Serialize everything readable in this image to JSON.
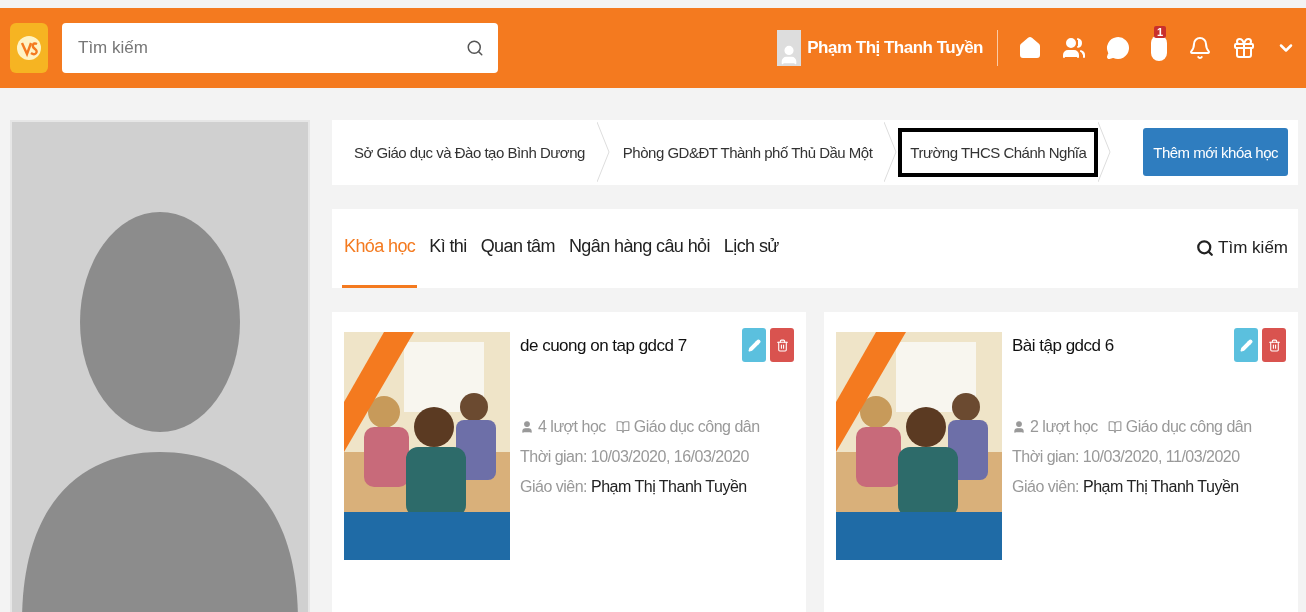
{
  "header": {
    "search": {
      "placeholder": "Tìm kiếm"
    },
    "user": {
      "name": "Phạm Thị Thanh Tuyền"
    },
    "notification_count": "1"
  },
  "breadcrumb": [
    {
      "label": "Sở Giáo dục và Đào tạo Bình Dương",
      "highlighted": false
    },
    {
      "label": "Phòng GD&ĐT Thành phố Thủ Dầu Một",
      "highlighted": false
    },
    {
      "label": "Trường THCS Chánh Nghĩa",
      "highlighted": true
    }
  ],
  "add_button": "Thêm mới khóa học",
  "tabs": [
    {
      "label": "Khóa học",
      "selected": true
    },
    {
      "label": "Kì thi",
      "selected": false
    },
    {
      "label": "Quan tâm",
      "selected": false
    },
    {
      "label": "Ngân hàng câu hỏi",
      "selected": false
    },
    {
      "label": "Lịch sử",
      "selected": false
    }
  ],
  "tab_search": "Tìm kiếm",
  "courses": [
    {
      "title": "de cuong on tap gdcd 7",
      "learners": "4 lượt học",
      "subject": "Giáo dục công dân",
      "time": "Thời gian: 10/03/2020, 16/03/2020",
      "teacher_label": "Giáo viên:",
      "teacher": "Phạm Thị Thanh Tuyền"
    },
    {
      "title": "Bài tập gdcd 6",
      "learners": "2 lượt học",
      "subject": "Giáo dục công dân",
      "time": "Thời gian: 10/03/2020, 11/03/2020",
      "teacher_label": "Giáo viên:",
      "teacher": "Phạm Thị Thanh Tuyền"
    }
  ]
}
